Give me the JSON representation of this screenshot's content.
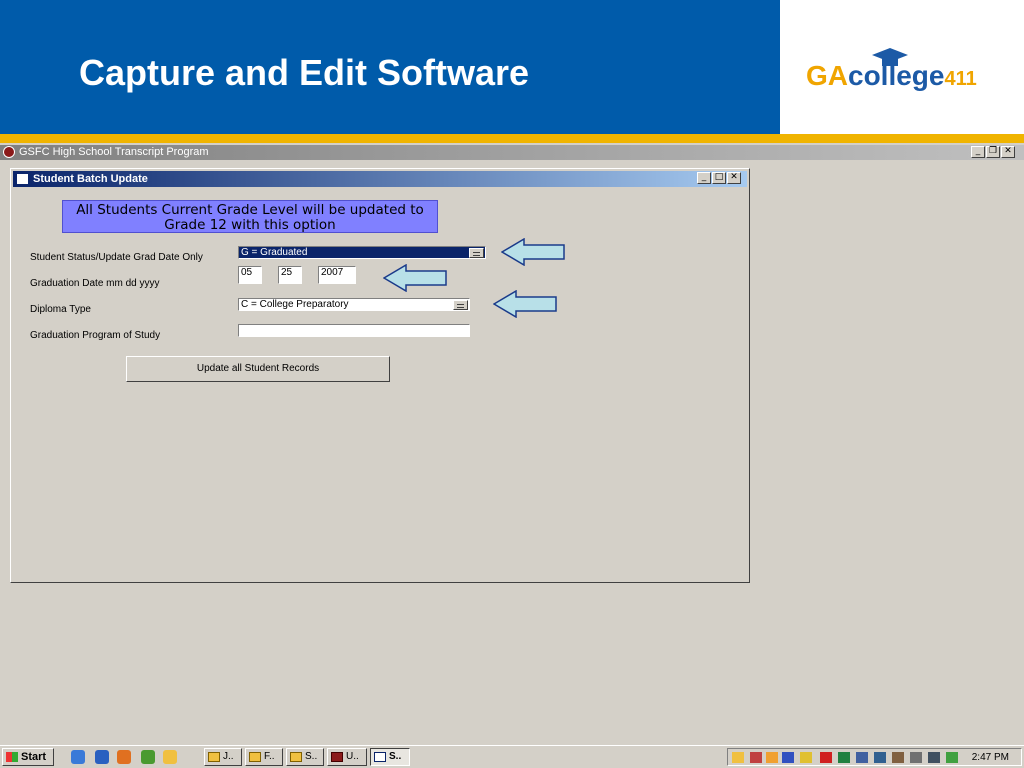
{
  "slide": {
    "title": "Capture and Edit Software"
  },
  "logo": {
    "ga": "GA",
    "college": "college",
    "num": "411"
  },
  "app": {
    "title": "GSFC High School Transcript Program"
  },
  "window": {
    "title": "Student Batch Update",
    "banner": "All Students Current Grade Level will be updated to Grade 12 with this option",
    "fields": {
      "status_label": "Student Status/Update Grad Date Only",
      "status_value": "G = Graduated",
      "grad_date_label": "Graduation Date  mm dd yyyy",
      "grad_month": "05",
      "grad_day": "25",
      "grad_year": "2007",
      "diploma_label": "Diploma Type",
      "diploma_value": "C = College Preparatory",
      "program_label": "Graduation Program of Study",
      "program_value": ""
    },
    "update_button": "Update all Student Records"
  },
  "taskbar": {
    "start": "Start",
    "tasks": [
      "J..",
      "F..",
      "S..",
      "U..",
      "S.."
    ],
    "clock": "2:47 PM"
  },
  "colors": {
    "header_blue": "#005baa",
    "gold": "#f0b400",
    "banner": "#8080ff",
    "arrow_fill": "#b8e0e8"
  }
}
